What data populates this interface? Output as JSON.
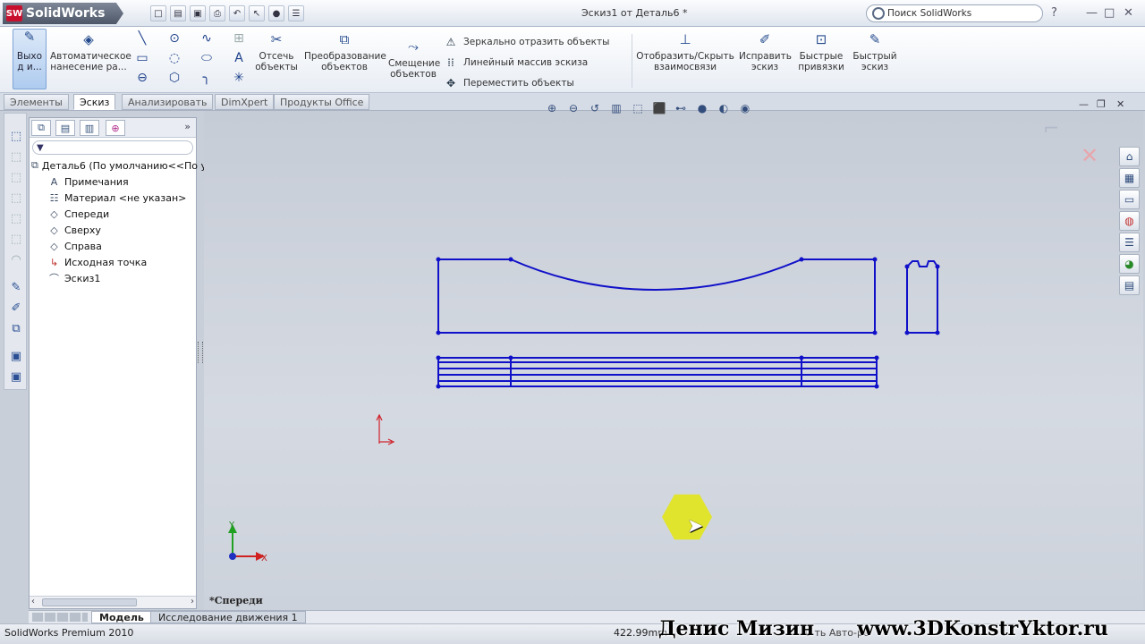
{
  "app": {
    "brand": "SolidWorks",
    "doc_title": "Эскиз1 от Деталь6 *"
  },
  "search": {
    "placeholder": "Поиск SolidWorks"
  },
  "ribbon": {
    "exit_label": "Выхо д и...",
    "smart_dim": "Автоматическое нанесение ра...",
    "trim": "Отсечь объекты",
    "convert": "Преобразование объектов",
    "offset": "Смещение объектов",
    "mirror": "Зеркально отразить объекты",
    "pattern": "Линейный массив эскиза",
    "move": "Переместить объекты",
    "relations": "Отобразить/Скрыть взаимосвязи",
    "repair": "Исправить эскиз",
    "snaps": "Быстрые привязки",
    "rapid": "Быстрый эскиз"
  },
  "tabs": [
    "Элементы",
    "Эскиз",
    "Анализировать",
    "DimXpert",
    "Продукты Office"
  ],
  "tree": {
    "root": "Деталь6  (По умолчанию<<По у",
    "items": [
      "Примечания",
      "Материал <не указан>",
      "Спереди",
      "Сверху",
      "Справа",
      "Исходная точка",
      "Эскиз1"
    ]
  },
  "view": {
    "label": "*Спереди",
    "axis_x": "X",
    "axis_y": "Y"
  },
  "bottom_tabs": [
    "Модель",
    "Исследование движения 1"
  ],
  "status": {
    "product": "SolidWorks Premium 2010",
    "coord": "422.99mm",
    "more": "0       ть Авто-ре"
  },
  "watermark": {
    "name": "Денис Мизин",
    "url": "www.3DKonstrYktor.ru"
  },
  "colors": {
    "sketch": "#1010c8",
    "accent": "#c8102e"
  }
}
